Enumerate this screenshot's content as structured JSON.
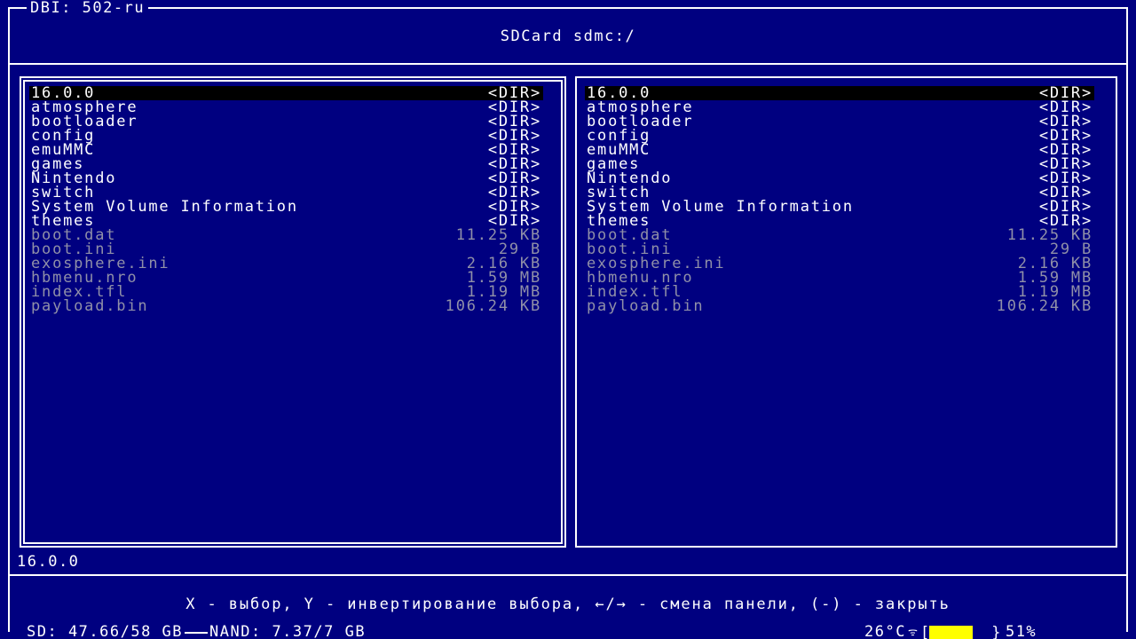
{
  "app": {
    "title": "DBI: 502-ru"
  },
  "location": "SDCard sdmc:/",
  "panels": [
    {
      "active": true,
      "items": [
        {
          "name": "16.0.0",
          "size": "<DIR>",
          "type": "dir",
          "selected": true
        },
        {
          "name": "atmosphere",
          "size": "<DIR>",
          "type": "dir"
        },
        {
          "name": "bootloader",
          "size": "<DIR>",
          "type": "dir"
        },
        {
          "name": "config",
          "size": "<DIR>",
          "type": "dir"
        },
        {
          "name": "emuMMC",
          "size": "<DIR>",
          "type": "dir"
        },
        {
          "name": "games",
          "size": "<DIR>",
          "type": "dir"
        },
        {
          "name": "Nintendo",
          "size": "<DIR>",
          "type": "dir"
        },
        {
          "name": "switch",
          "size": "<DIR>",
          "type": "dir"
        },
        {
          "name": "System Volume Information",
          "size": "<DIR>",
          "type": "dir"
        },
        {
          "name": "themes",
          "size": "<DIR>",
          "type": "dir"
        },
        {
          "name": "boot.dat",
          "size": "11.25 KB",
          "type": "file"
        },
        {
          "name": "boot.ini",
          "size": "29 B",
          "type": "file"
        },
        {
          "name": "exosphere.ini",
          "size": "2.16 KB",
          "type": "file"
        },
        {
          "name": "hbmenu.nro",
          "size": "1.59 MB",
          "type": "file"
        },
        {
          "name": "index.tfl",
          "size": "1.19 MB",
          "type": "file"
        },
        {
          "name": "payload.bin",
          "size": "106.24 KB",
          "type": "file"
        }
      ]
    },
    {
      "active": false,
      "items": [
        {
          "name": "16.0.0",
          "size": "<DIR>",
          "type": "dir",
          "selected": true
        },
        {
          "name": "atmosphere",
          "size": "<DIR>",
          "type": "dir"
        },
        {
          "name": "bootloader",
          "size": "<DIR>",
          "type": "dir"
        },
        {
          "name": "config",
          "size": "<DIR>",
          "type": "dir"
        },
        {
          "name": "emuMMC",
          "size": "<DIR>",
          "type": "dir"
        },
        {
          "name": "games",
          "size": "<DIR>",
          "type": "dir"
        },
        {
          "name": "Nintendo",
          "size": "<DIR>",
          "type": "dir"
        },
        {
          "name": "switch",
          "size": "<DIR>",
          "type": "dir"
        },
        {
          "name": "System Volume Information",
          "size": "<DIR>",
          "type": "dir"
        },
        {
          "name": "themes",
          "size": "<DIR>",
          "type": "dir"
        },
        {
          "name": "boot.dat",
          "size": "11.25 KB",
          "type": "file"
        },
        {
          "name": "boot.ini",
          "size": "29 B",
          "type": "file"
        },
        {
          "name": "exosphere.ini",
          "size": "2.16 KB",
          "type": "file"
        },
        {
          "name": "hbmenu.nro",
          "size": "1.59 MB",
          "type": "file"
        },
        {
          "name": "index.tfl",
          "size": "1.19 MB",
          "type": "file"
        },
        {
          "name": "payload.bin",
          "size": "106.24 KB",
          "type": "file"
        }
      ]
    }
  ],
  "current_item": "16.0.0",
  "help_text": "X - выбор, Y - инвертирование выбора, ←/→ - смена панели, (-) - закрыть",
  "status": {
    "sd": "SD: 47.66/58 GB",
    "nand": "NAND: 7.37/7 GB",
    "temperature": "26°C",
    "wifi_icon": "wifi-icon",
    "battery_percent": "51%",
    "battery_level": 0.51
  },
  "colors": {
    "background": "#000080",
    "foreground": "#ffffff",
    "file_text": "#9090a8",
    "selection": "#000000",
    "battery": "#ffff00"
  }
}
